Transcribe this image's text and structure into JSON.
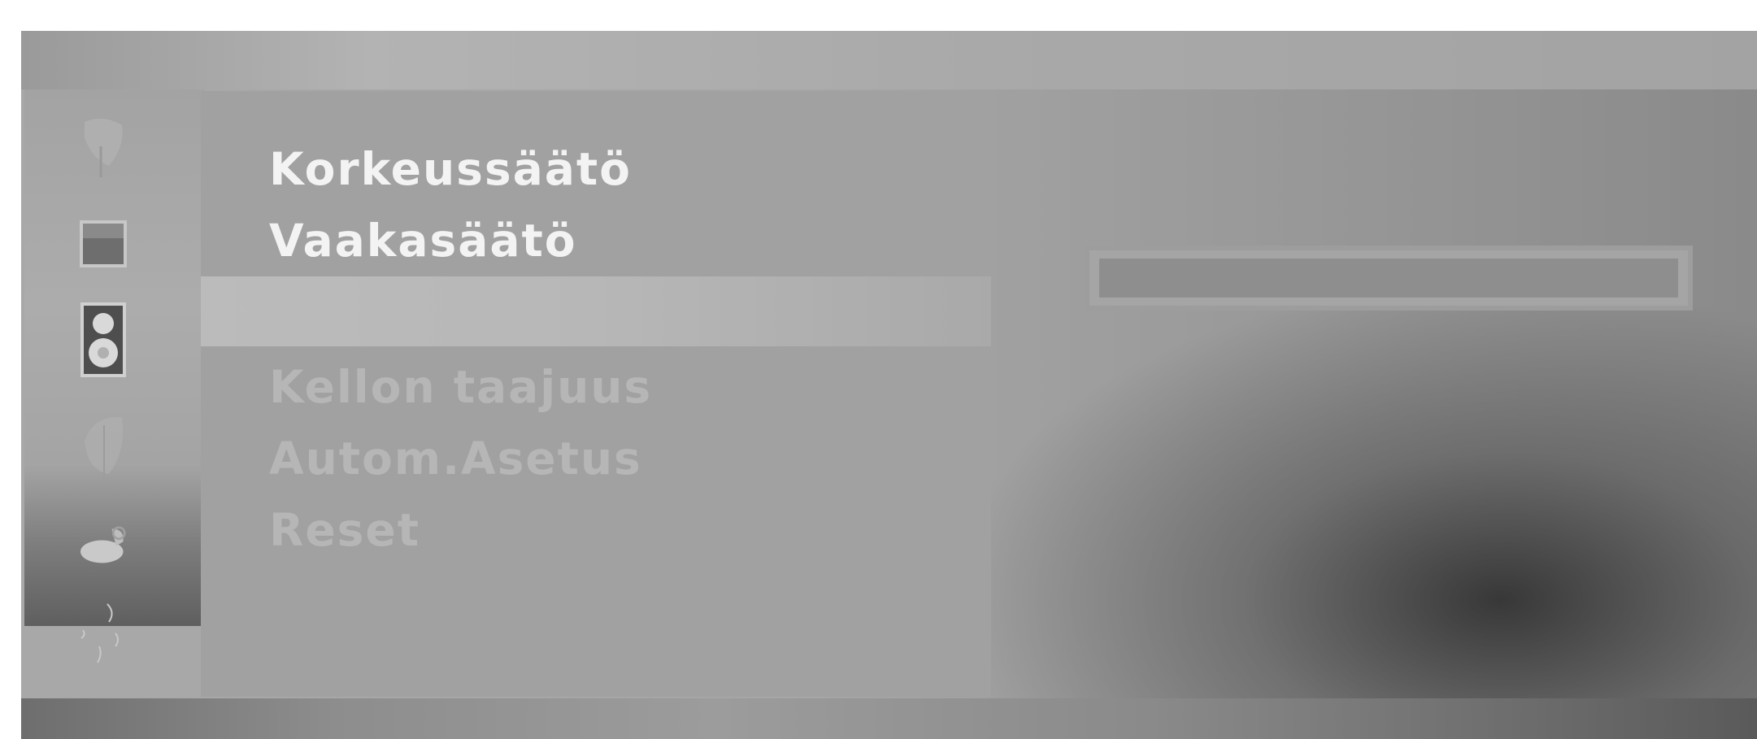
{
  "menu": {
    "items": [
      {
        "label": "Korkeussäätö",
        "state": "active"
      },
      {
        "label": "Vaakasäätö",
        "state": "active"
      },
      {
        "label": "",
        "state": "selected"
      },
      {
        "label": "Kellon taajuus",
        "state": "dim"
      },
      {
        "label": "Autom.Asetus",
        "state": "dim"
      },
      {
        "label": "Reset",
        "state": "dim"
      }
    ]
  },
  "sidebar": {
    "icons": [
      "picture-mode-icon",
      "screen-icon",
      "speaker-icon",
      "time-icon",
      "special-icon",
      "swirl-icon"
    ]
  },
  "value_bar": {
    "fill": 0.0
  },
  "colors": {
    "active_text": "#f3f3f3",
    "dim_text": "#b6b6b6",
    "selected_row": "#bbbbbb"
  }
}
